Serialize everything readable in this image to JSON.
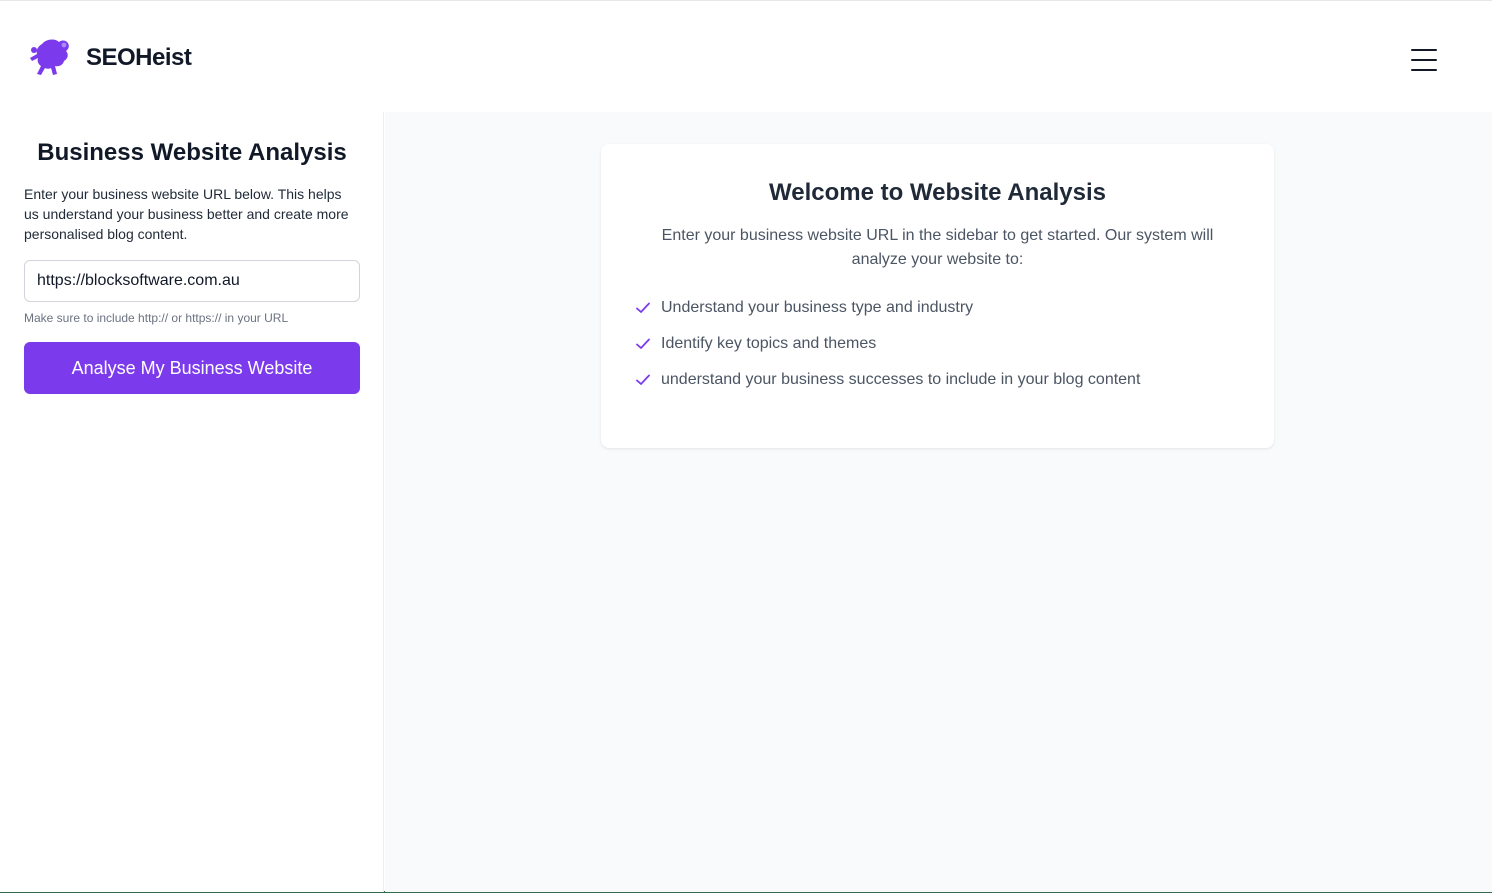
{
  "header": {
    "brand": "SEOHeist",
    "logo_icon": "seoheist-logo-icon",
    "menu_icon": "hamburger-menu-icon"
  },
  "sidebar": {
    "title": "Business Website Analysis",
    "description": "Enter your business website URL below. This helps us understand your business better and create more personalised blog content.",
    "url_input": {
      "value": "https://blocksoftware.com.au",
      "placeholder": ""
    },
    "hint": "Make sure to include http:// or https:// in your URL",
    "analyse_button": "Analyse My Business Website"
  },
  "main": {
    "card": {
      "title": "Welcome to Website Analysis",
      "description": "Enter your business website URL in the sidebar to get started. Our system will analyze your website to:",
      "features": [
        "Understand your business type and industry",
        "Identify key topics and themes",
        "understand your business successes to include in your blog content"
      ]
    }
  },
  "colors": {
    "accent": "#7c3aed",
    "main_background": "#f9fafb",
    "text_dark": "#111827",
    "text_muted": "#4b5563"
  }
}
